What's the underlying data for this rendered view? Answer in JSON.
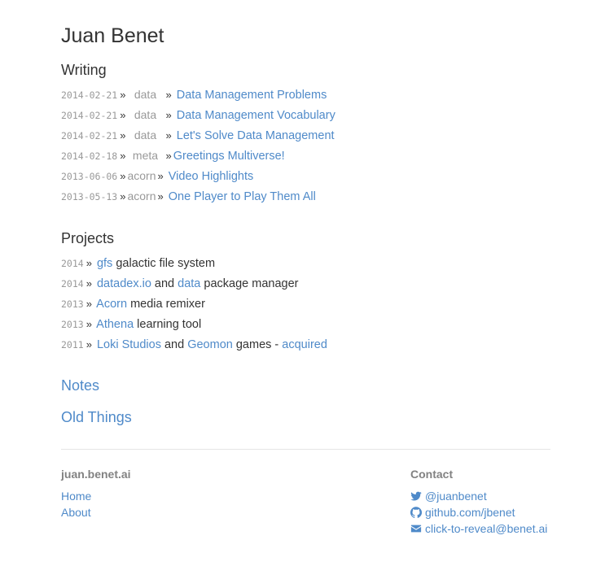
{
  "header": {
    "title": "Juan Benet"
  },
  "writing": {
    "heading": "Writing",
    "posts": [
      {
        "date": "2014-02-21",
        "sep": "»",
        "category": "data",
        "title": "Data Management Problems"
      },
      {
        "date": "2014-02-21",
        "sep": "»",
        "category": "data",
        "title": "Data Management Vocabulary"
      },
      {
        "date": "2014-02-21",
        "sep": "»",
        "category": "data",
        "title": "Let's Solve Data Management"
      },
      {
        "date": "2014-02-18",
        "sep": "»",
        "category": "meta",
        "title": "Greetings Multiverse!"
      },
      {
        "date": "2013-06-06",
        "sep": "»",
        "category": "acorn",
        "title": "Video Highlights"
      },
      {
        "date": "2013-05-13",
        "sep": "»",
        "category": "acorn",
        "title": "One Player to Play Them All"
      }
    ]
  },
  "projects": {
    "heading": "Projects",
    "items": [
      {
        "year": "2014",
        "sep": "»",
        "link1": "gfs",
        "text1": " galactic file system"
      },
      {
        "year": "2014",
        "sep": "»",
        "link1": "datadex.io",
        "text1": " and ",
        "link2": "data",
        "text2": " package manager"
      },
      {
        "year": "2013",
        "sep": "»",
        "link1": "Acorn",
        "text1": " media remixer"
      },
      {
        "year": "2013",
        "sep": "»",
        "link1": "Athena",
        "text1": " learning tool"
      },
      {
        "year": "2011",
        "sep": "»",
        "link1": "Loki Studios",
        "text1": " and ",
        "link2": "Geomon",
        "text2": " games - ",
        "link3": "acquired"
      }
    ]
  },
  "links": {
    "notes": "Notes",
    "old_things": "Old Things"
  },
  "footer": {
    "site_name": "juan.benet.ai",
    "home": "Home",
    "about": "About",
    "contact_heading": "Contact",
    "twitter": "@juanbenet",
    "github": "github.com/jbenet",
    "email": "click-to-reveal@benet.ai"
  },
  "colors": {
    "link": "#4f8ac9",
    "muted": "#999999",
    "text": "#333333",
    "footer_heading": "#828282",
    "rule": "#e5e5e5"
  }
}
